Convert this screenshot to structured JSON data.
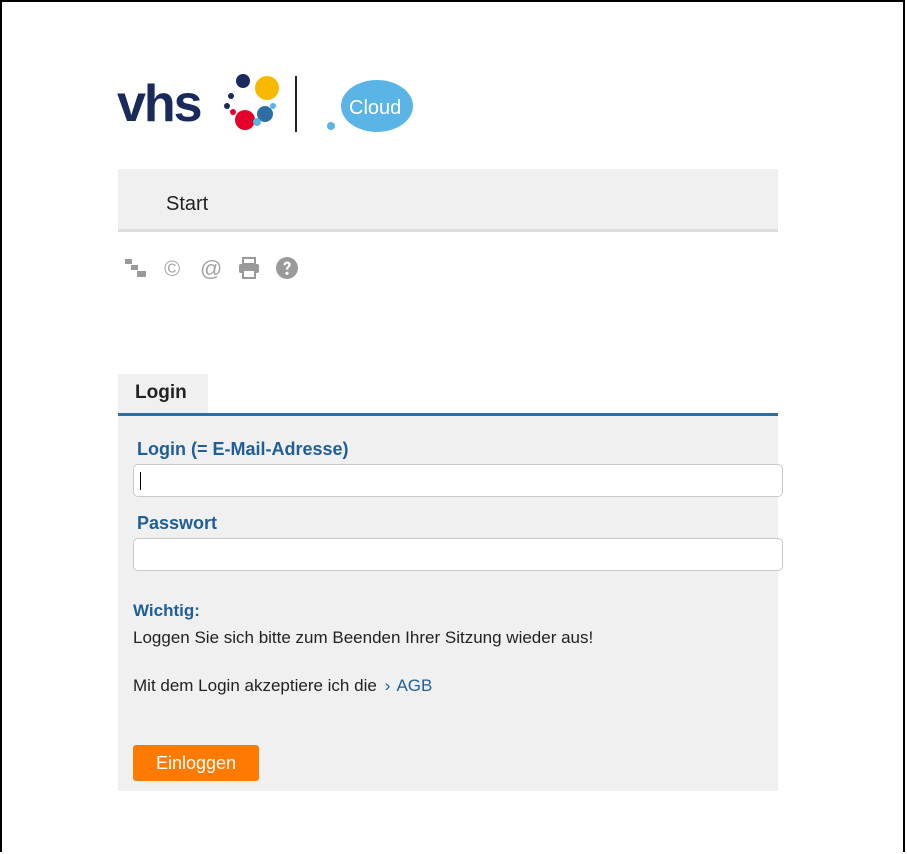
{
  "logo": {
    "brand": "vhs",
    "badge_label": "Cloud"
  },
  "nav": {
    "items": [
      {
        "label": "Start"
      }
    ]
  },
  "toolbar": {
    "icons": [
      "sitemap-icon",
      "copyright-icon",
      "at-icon",
      "print-icon",
      "help-icon"
    ],
    "copyright_glyph": "©",
    "at_glyph": "@"
  },
  "login": {
    "tab_label": "Login",
    "email_label": "Login (= E-Mail-Adresse)",
    "email_value": "",
    "password_label": "Passwort",
    "password_value": "",
    "important_title": "Wichtig:",
    "important_text": "Loggen Sie sich bitte zum Beenden Ihrer Sitzung wieder aus!",
    "agb_prefix": "Mit dem Login akzeptiere ich die",
    "agb_chevron": "›",
    "agb_link": "AGB",
    "submit_label": "Einloggen"
  },
  "colors": {
    "brand_navy": "#1b2a5c",
    "link_blue": "#1f5f99",
    "accent_orange": "#ff7a00",
    "cloud_blue": "#5ab4e6",
    "panel_grey": "#f0f0f0"
  }
}
